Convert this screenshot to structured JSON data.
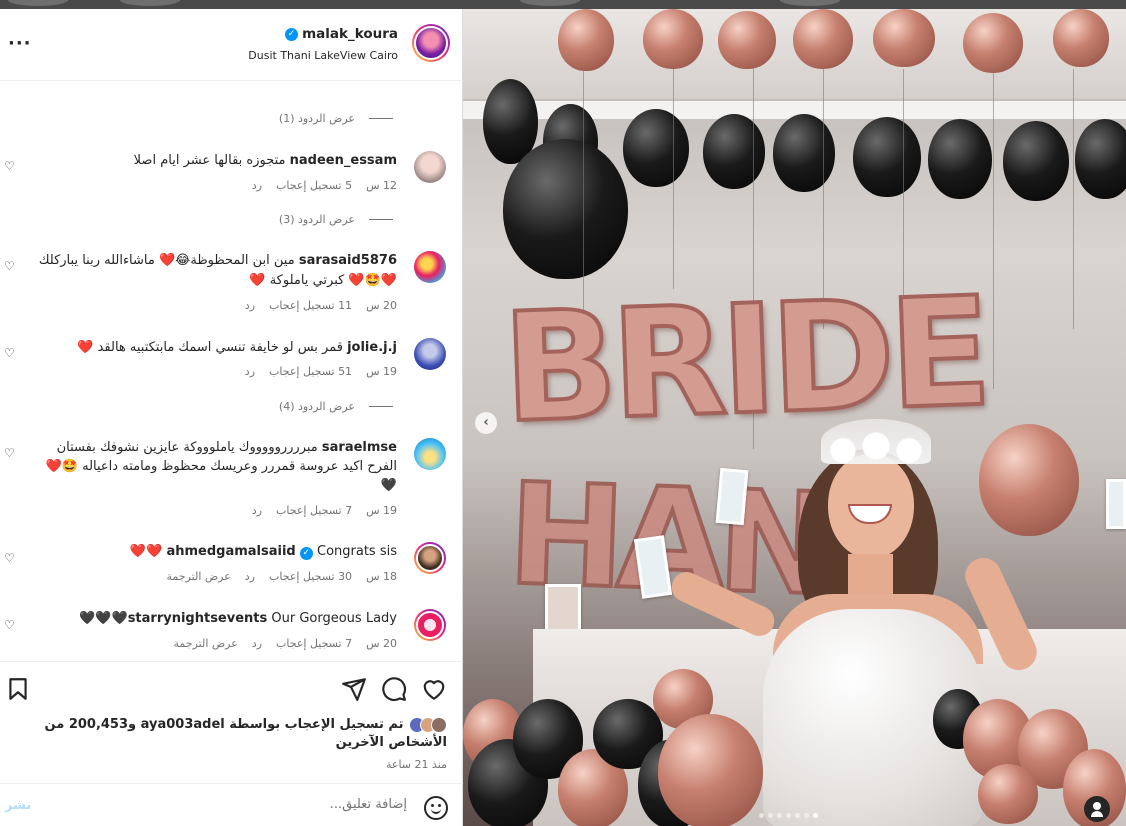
{
  "post": {
    "author": "malak_koura",
    "location": "Dusit Thani LakeView Cairo",
    "likes_text": "تم تسجيل الإعجاب بواسطة aya003adel و200,453 من الأشخاص الآخرين",
    "time_ago": "منذ 21 ساعة",
    "comment_placeholder": "إضافة تعليق...",
    "post_label": "نشر",
    "image_text": "BRIDE"
  },
  "replies": [
    {
      "label": "عرض الردود (1)"
    },
    {
      "label": "عرض الردود (3)"
    },
    {
      "label": "عرض الردود (4)"
    }
  ],
  "comments": [
    {
      "user": "nadeen_essam",
      "text": "متجوزه بقالها عشر ايام اصلا",
      "time": "12 س",
      "likes": "5 تسجيل إعجاب",
      "reply": "رد"
    },
    {
      "user": "sarasaid5876",
      "text": "مين ابن المحظوظة😂❤️ ماشاءالله ربنا يباركلك ❤️🤩❤️ كبرتي ياملوكة ❤️",
      "time": "20 س",
      "likes": "11 تسجيل إعجاب",
      "reply": "رد"
    },
    {
      "user": "jolie.j.j",
      "text": "قمر بس لو خايفة تنسي اسمك مابتكتبيه هالقد ❤️",
      "time": "19 س",
      "likes": "51 تسجيل إعجاب",
      "reply": "رد"
    },
    {
      "user": "saraelmse",
      "text": "مبرررروووووك ياملوووكة عايزين نشوفك بفستان الفرح اكيد عروسة قمررر وعريسك محظوظ ومامته داعياله 🤩❤️🖤",
      "time": "19 س",
      "likes": "7 تسجيل إعجاب",
      "reply": "رد"
    },
    {
      "user": "ahmedgamalsaiid",
      "text": "Congrats sis ❤️❤️",
      "time": "18 س",
      "likes": "30 تسجيل إعجاب",
      "reply": "رد",
      "translate": "عرض الترجمة"
    },
    {
      "user": "starrynightsevents",
      "text": "Our Gorgeous Lady🖤🖤🖤",
      "time": "20 س",
      "likes": "7 تسجيل إعجاب",
      "reply": "رد",
      "translate": "عرض الترجمة"
    }
  ],
  "icons": {
    "more": "more-options-icon",
    "heart": "heart-icon",
    "comment": "comment-icon",
    "share": "share-icon",
    "save": "bookmark-icon",
    "emoji": "emoji-icon",
    "verified": "verified-badge-icon",
    "prev": "chevron-left-icon",
    "user_tag": "user-tag-icon"
  },
  "colors": {
    "link_blue": "#0095f6",
    "post_btn_disabled": "#b2dffc",
    "muted": "#737373"
  },
  "carousel": {
    "total": 7,
    "active": 7
  }
}
